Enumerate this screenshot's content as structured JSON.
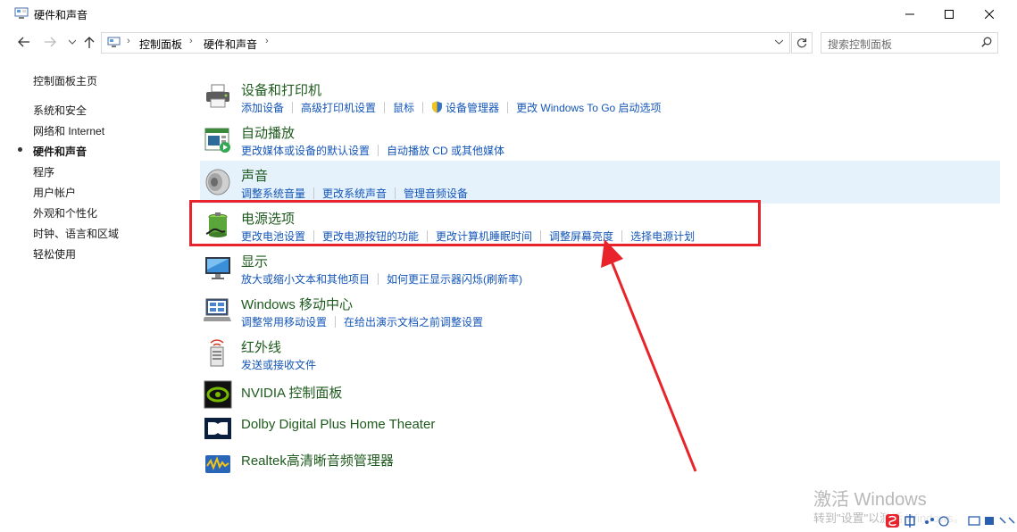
{
  "window": {
    "title": "硬件和声音",
    "icon": "control-panel-icon"
  },
  "address": {
    "breadcrumbs": [
      "控制面板",
      "硬件和声音"
    ],
    "search_placeholder": "搜索控制面板"
  },
  "sidebar": {
    "items": [
      {
        "label": "控制面板主页",
        "active": false
      },
      {
        "label": "系统和安全",
        "active": false
      },
      {
        "label": "网络和 Internet",
        "active": false
      },
      {
        "label": "硬件和声音",
        "active": true
      },
      {
        "label": "程序",
        "active": false
      },
      {
        "label": "用户帐户",
        "active": false
      },
      {
        "label": "外观和个性化",
        "active": false
      },
      {
        "label": "时钟、语言和区域",
        "active": false
      },
      {
        "label": "轻松使用",
        "active": false
      }
    ]
  },
  "categories": [
    {
      "title": "设备和打印机",
      "icon": "printer-icon",
      "links": [
        "添加设备",
        "高级打印机设置",
        "鼠标",
        "设备管理器",
        "更改 Windows To Go 启动选项"
      ]
    },
    {
      "title": "自动播放",
      "icon": "autoplay-icon",
      "links": [
        "更改媒体或设备的默认设置",
        "自动播放 CD 或其他媒体"
      ]
    },
    {
      "title": "声音",
      "icon": "speaker-icon",
      "links": [
        "调整系统音量",
        "更改系统声音",
        "管理音频设备"
      ],
      "highlighted": true
    },
    {
      "title": "电源选项",
      "icon": "battery-icon",
      "links": [
        "更改电池设置",
        "更改电源按钮的功能",
        "更改计算机睡眠时间",
        "调整屏幕亮度",
        "选择电源计划"
      ]
    },
    {
      "title": "显示",
      "icon": "monitor-icon",
      "links": [
        "放大或缩小文本和其他项目",
        "如何更正显示器闪烁(刷新率)"
      ]
    },
    {
      "title": "Windows 移动中心",
      "icon": "mobility-center-icon",
      "links": [
        "调整常用移动设置",
        "在给出演示文档之前调整设置"
      ]
    },
    {
      "title": "红外线",
      "icon": "infrared-icon",
      "links": [
        "发送或接收文件"
      ]
    },
    {
      "title": "NVIDIA 控制面板",
      "icon": "nvidia-icon",
      "links": []
    },
    {
      "title": "Dolby Digital Plus Home Theater",
      "icon": "dolby-icon",
      "links": []
    },
    {
      "title": "Realtek高清晰音频管理器",
      "icon": "realtek-icon",
      "links": []
    }
  ],
  "watermark": {
    "line1": "激活 Windows",
    "line2": "转到\"设置\"以激活 Windows。"
  },
  "colors": {
    "category_title": "#1e5a1e",
    "link": "#1456b8",
    "highlight": "#e5f1fb",
    "annotation_red": "#e8232b"
  }
}
